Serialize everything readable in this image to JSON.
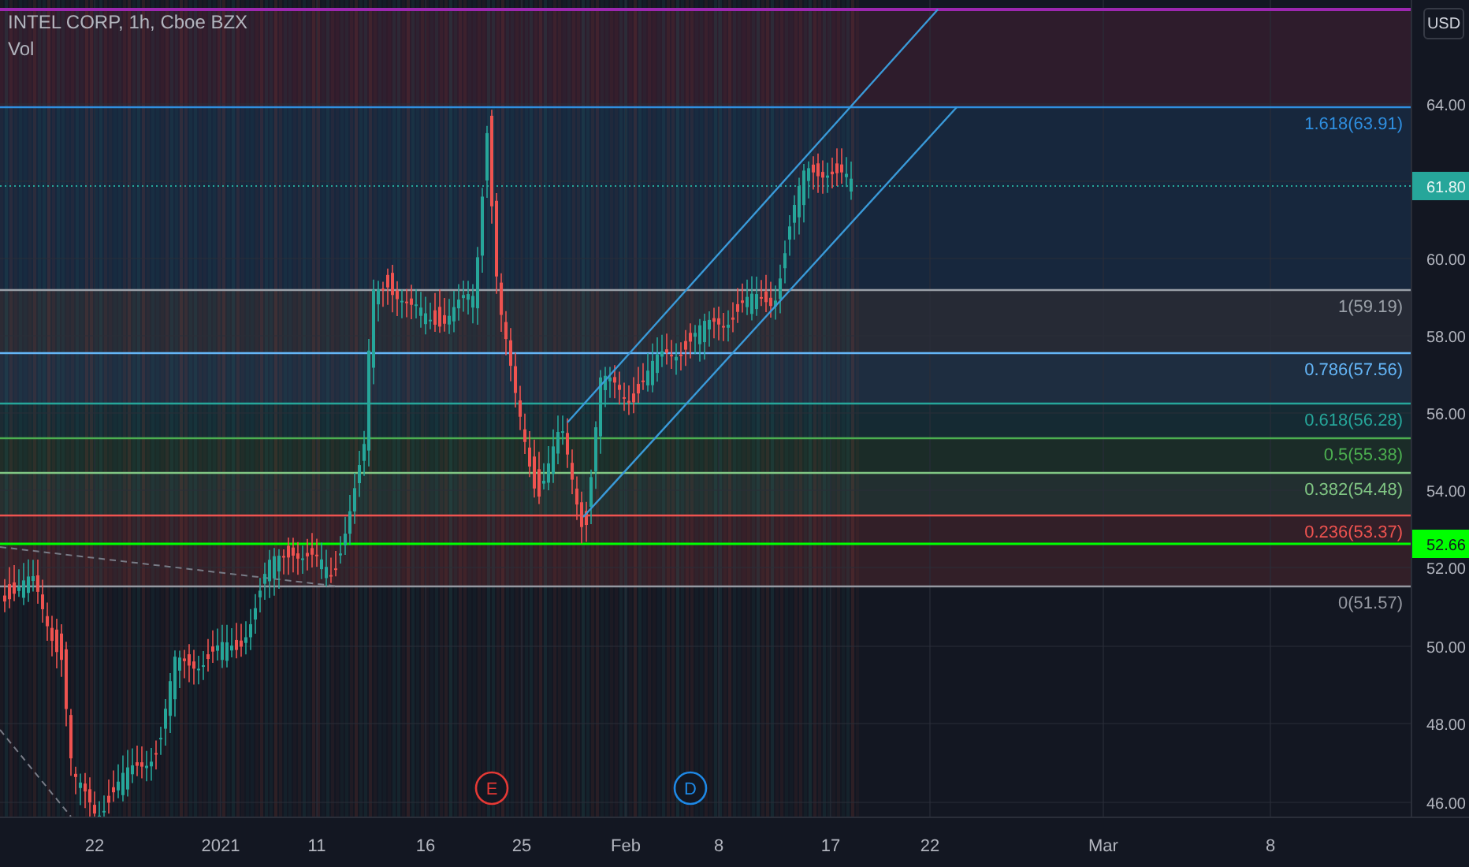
{
  "header": {
    "title": "INTEL CORP, 1h, Cboe BZX",
    "indicator": "Vol"
  },
  "currency": "USD",
  "price_axis": {
    "ticks": [
      "64.00",
      "60.00",
      "58.00",
      "56.00",
      "54.00",
      "52.00",
      "50.00",
      "48.00",
      "46.00"
    ]
  },
  "price_tags": [
    {
      "label": "61.80",
      "color": "#26a69a"
    },
    {
      "label": "52.66",
      "color": "#00ff00"
    }
  ],
  "fib_levels": [
    {
      "label": "1.618(63.91)",
      "color": "#2f8fe0"
    },
    {
      "label": "1(59.19)",
      "color": "#9aa0a8"
    },
    {
      "label": "0.786(57.56)",
      "color": "#64b5f6"
    },
    {
      "label": "0.618(56.28)",
      "color": "#26a69a"
    },
    {
      "label": "0.5(55.38)",
      "color": "#4caf50"
    },
    {
      "label": "0.382(54.48)",
      "color": "#81c784"
    },
    {
      "label": "0.236(53.37)",
      "color": "#ef5350"
    },
    {
      "label": "0(51.57)",
      "color": "#9598a1"
    }
  ],
  "events": [
    {
      "label": "E",
      "color": "#e53935"
    },
    {
      "label": "D",
      "color": "#1e88e5"
    }
  ],
  "time_axis": {
    "ticks": [
      "22",
      "2021",
      "11",
      "16",
      "25",
      "Feb",
      "8",
      "17",
      "22",
      "Mar",
      "8"
    ]
  }
}
